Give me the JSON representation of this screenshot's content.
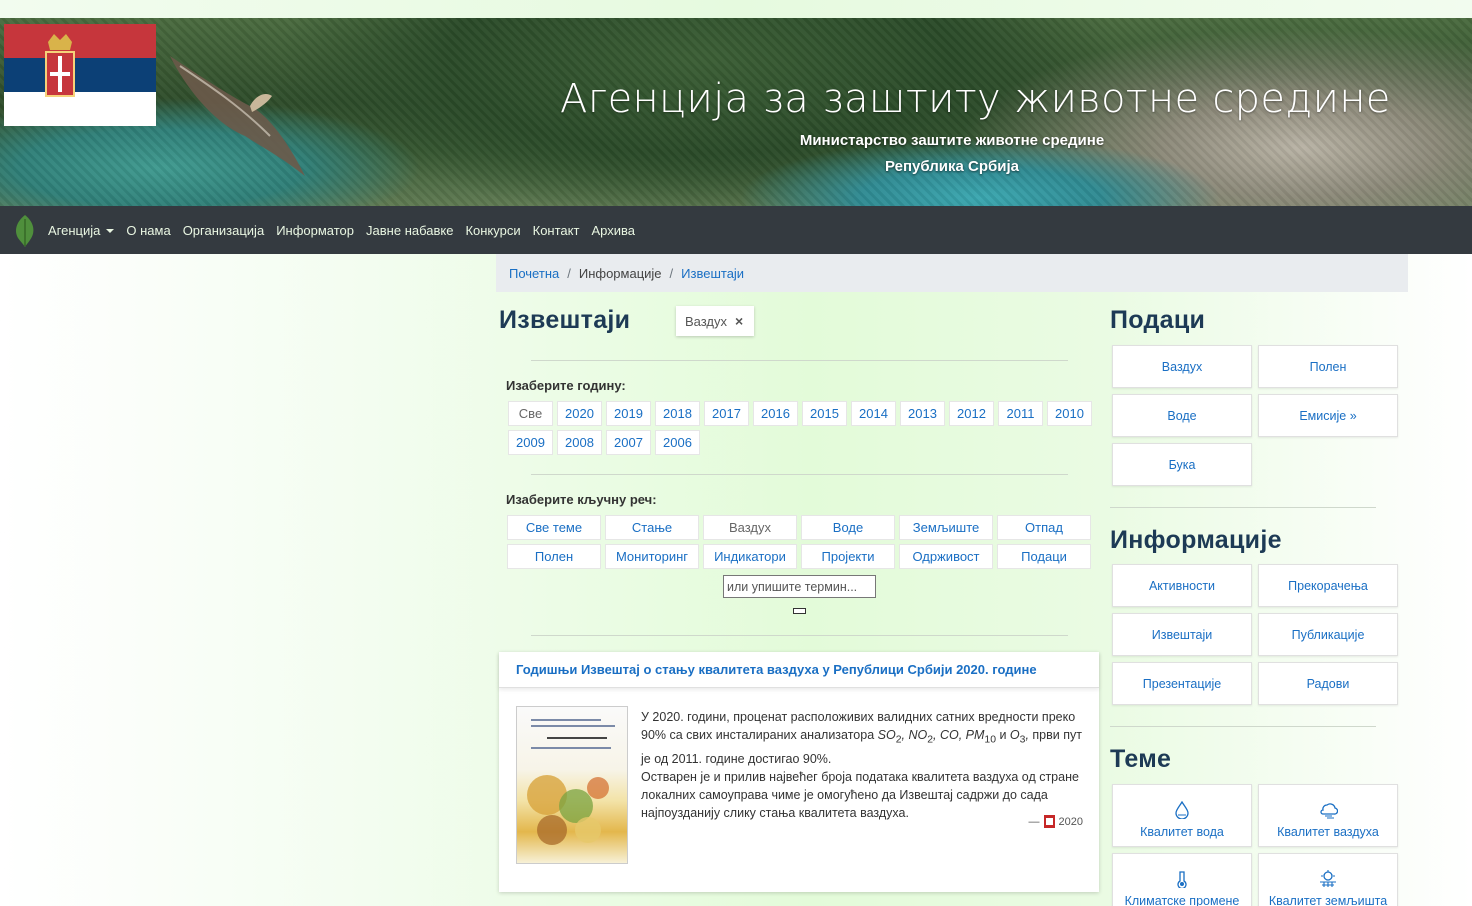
{
  "header": {
    "title": "Агенција за заштиту животне средине",
    "subtitle1": "Министарство заштите животне средине",
    "subtitle2": "Република Србија"
  },
  "nav": {
    "items": [
      "Агенција",
      "О нама",
      "Организација",
      "Информатор",
      "Јавне набавке",
      "Конкурси",
      "Контакт",
      "Архива"
    ]
  },
  "breadcrumb": {
    "home": "Почетна",
    "middle": "Информације",
    "current": "Извештаји"
  },
  "main": {
    "title": "Извештаји",
    "active_filter": "Ваздух",
    "filter_close": "×",
    "year_label": "Изаберите годину:",
    "years": [
      "Све",
      "2020",
      "2019",
      "2018",
      "2017",
      "2016",
      "2015",
      "2014",
      "2013",
      "2012",
      "2011",
      "2010",
      "2009",
      "2008",
      "2007",
      "2006"
    ],
    "keyword_label": "Изаберите кључну реч:",
    "keywords": [
      "Све теме",
      "Стање",
      "Ваздух",
      "Воде",
      "Земљиште",
      "Отпад",
      "Полен",
      "Мониторинг",
      "Индикатори",
      "Пројекти",
      "Одрживост",
      "Подаци"
    ],
    "search_placeholder": "или упишите термин..."
  },
  "report": {
    "title": "Годишњи Извештај о стању квалитета ваздуха у Републици Србији 2020. године",
    "para1_a": "У 2020. години, проценат расположивих валидних сатних вредности преко 90% са свих инсталираних анализатора ",
    "para1_b": " први пут је од 2011. године достигао 90%.",
    "para2": "Остварен је и прилив највећег броја података квалитета ваздуха од стране локалних самоуправа чиме је омогућено да Извештај садржи до сада најпоузданију слику стања квалитета ваздуха.",
    "dash": "—",
    "year": "2020",
    "pdf_icon": "pdf-icon"
  },
  "sidebar": {
    "data_heading": "Подаци",
    "data_items": [
      "Ваздух",
      "Полен",
      "Воде",
      "Емисије »",
      "Бука"
    ],
    "info_heading": "Информације",
    "info_items": [
      "Активности",
      "Прекорачења",
      "Извештаји",
      "Публикације",
      "Презентације",
      "Радови"
    ],
    "topics_heading": "Теме",
    "topics_items": [
      {
        "label": "Квалитет вода",
        "icon": "water-drop-icon"
      },
      {
        "label": "Квалитет ваздуха",
        "icon": "cloud-wind-icon"
      },
      {
        "label": "Климатске промене",
        "icon": "thermometer-icon"
      },
      {
        "label": "Квалитет земљишта",
        "icon": "soil-icon"
      }
    ]
  },
  "colors": {
    "navbar": "#343a40",
    "link": "#1a6fc4",
    "heading": "#1d3a55",
    "flag_red": "#c6363c",
    "flag_blue": "#0c4076"
  }
}
